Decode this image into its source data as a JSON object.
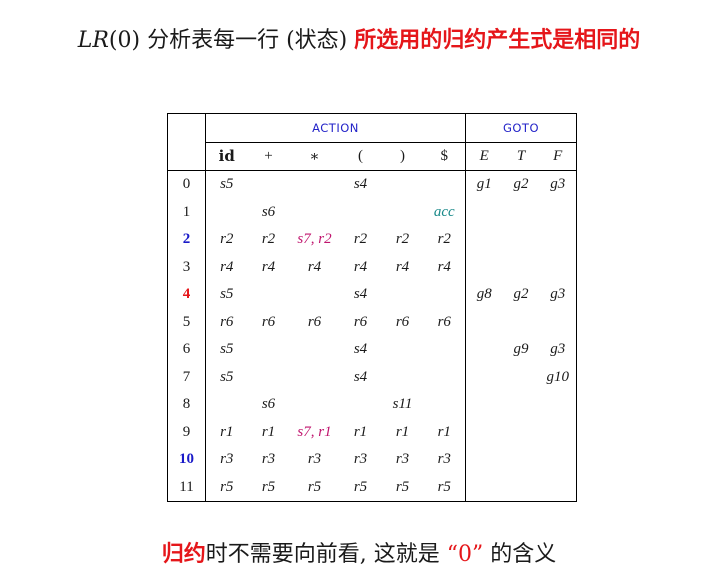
{
  "title": {
    "lr": "LR",
    "zero": "(0)",
    "mid": " 分析表每一行 (状态) ",
    "red": "所选用的归约产生式是相同的"
  },
  "table": {
    "action_label": "ACTION",
    "goto_label": "GOTO",
    "action_headers": [
      "id",
      "+",
      "∗",
      "(",
      ")",
      "$"
    ],
    "goto_headers": [
      "E",
      "T",
      "F"
    ],
    "rows": [
      {
        "state": "0",
        "cells": [
          "s5",
          "",
          "",
          "s4",
          "",
          "",
          "g1",
          "g2",
          "g3"
        ]
      },
      {
        "state": "1",
        "cells": [
          "",
          "s6",
          "",
          "",
          "",
          "acc",
          "",
          "",
          ""
        ]
      },
      {
        "state": "2",
        "cells": [
          "r2",
          "r2",
          "s7, r2",
          "r2",
          "r2",
          "r2",
          "",
          "",
          ""
        ]
      },
      {
        "state": "3",
        "cells": [
          "r4",
          "r4",
          "r4",
          "r4",
          "r4",
          "r4",
          "",
          "",
          ""
        ]
      },
      {
        "state": "4",
        "cells": [
          "s5",
          "",
          "",
          "s4",
          "",
          "",
          "g8",
          "g2",
          "g3"
        ]
      },
      {
        "state": "5",
        "cells": [
          "r6",
          "r6",
          "r6",
          "r6",
          "r6",
          "r6",
          "",
          "",
          ""
        ]
      },
      {
        "state": "6",
        "cells": [
          "s5",
          "",
          "",
          "s4",
          "",
          "",
          "",
          "g9",
          "g3"
        ]
      },
      {
        "state": "7",
        "cells": [
          "s5",
          "",
          "",
          "s4",
          "",
          "",
          "",
          "",
          "g10"
        ]
      },
      {
        "state": "8",
        "cells": [
          "",
          "s6",
          "",
          "",
          "s11",
          "",
          "",
          "",
          ""
        ]
      },
      {
        "state": "9",
        "cells": [
          "r1",
          "r1",
          "s7, r1",
          "r1",
          "r1",
          "r1",
          "",
          "",
          ""
        ]
      },
      {
        "state": "10",
        "cells": [
          "r3",
          "r3",
          "r3",
          "r3",
          "r3",
          "r3",
          "",
          "",
          ""
        ]
      },
      {
        "state": "11",
        "cells": [
          "r5",
          "r5",
          "r5",
          "r5",
          "r5",
          "r5",
          "",
          "",
          ""
        ]
      }
    ],
    "state_colors": {
      "2": "blue",
      "4": "red",
      "10": "blue"
    },
    "conflict_cells": [
      "s7, r2",
      "s7, r1"
    ],
    "accept_cell": "acc"
  },
  "bottom": {
    "red": "归约",
    "mid": "时不需要向前看, 这就是 ",
    "quote": "“0”",
    "end": " 的含义"
  },
  "colors": {
    "accent_red": "#e5161a",
    "header_blue": "#2323c8",
    "state_blue": "#1a1ac8",
    "conflict_magenta": "#c0156e",
    "accept_teal": "#1a8a8a"
  }
}
